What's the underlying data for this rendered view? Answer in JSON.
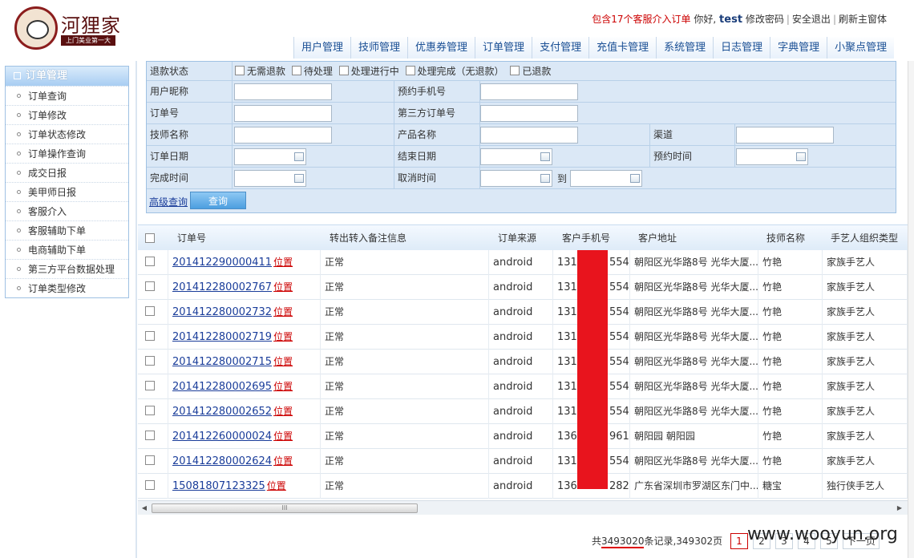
{
  "header": {
    "logo_title": "河狸家",
    "logo_subtitle": "上门美业第一大",
    "alert_text": "包含17个客服介入订单",
    "greeting": "你好,",
    "username": "test",
    "links": [
      "修改密码",
      "安全退出",
      "刷新主窗体"
    ],
    "nav": [
      "用户管理",
      "技师管理",
      "优惠券管理",
      "订单管理",
      "支付管理",
      "充值卡管理",
      "系统管理",
      "日志管理",
      "字典管理",
      "小聚点管理"
    ]
  },
  "sidebar": {
    "title": "订单管理",
    "items": [
      "订单查询",
      "订单修改",
      "订单状态修改",
      "订单操作查询",
      "成交日报",
      "美甲师日报",
      "客服介入",
      "客服辅助下单",
      "电商辅助下单",
      "第三方平台数据处理",
      "订单类型修改"
    ]
  },
  "form": {
    "refund_label": "退款状态",
    "refund_options": [
      "无需退款",
      "待处理",
      "处理进行中",
      "处理完成（无退款）",
      "已退款"
    ],
    "user_nick_label": "用户昵称",
    "phone_label": "预约手机号",
    "order_no_label": "订单号",
    "third_order_label": "第三方订单号",
    "tech_label": "技师名称",
    "product_label": "产品名称",
    "channel_label": "渠道",
    "order_date_label": "订单日期",
    "end_date_label": "结束日期",
    "appoint_time_label": "预约时间",
    "finish_time_label": "完成时间",
    "cancel_time_label": "取消时间",
    "to_label": "到",
    "advanced_link": "高级查询",
    "query_button": "查询"
  },
  "table": {
    "headers": [
      "订单号",
      "转出转入备注信息",
      "订单来源",
      "客户手机号",
      "客户地址",
      "技师名称",
      "手艺人组织类型"
    ],
    "rows": [
      {
        "order": "201412290000411",
        "loc": "位置",
        "remark": "正常",
        "source": "android",
        "phone_pre": "131",
        "phone_suf": "554",
        "addr": "朝阳区光华路8号 光华大厦...",
        "tech": "竹艳",
        "type": "家族手艺人"
      },
      {
        "order": "201412280002767",
        "loc": "位置",
        "remark": "正常",
        "source": "android",
        "phone_pre": "131",
        "phone_suf": "554",
        "addr": "朝阳区光华路8号 光华大厦...",
        "tech": "竹艳",
        "type": "家族手艺人"
      },
      {
        "order": "201412280002732",
        "loc": "位置",
        "remark": "正常",
        "source": "android",
        "phone_pre": "131",
        "phone_suf": "554",
        "addr": "朝阳区光华路8号 光华大厦...",
        "tech": "竹艳",
        "type": "家族手艺人"
      },
      {
        "order": "201412280002719",
        "loc": "位置",
        "remark": "正常",
        "source": "android",
        "phone_pre": "131",
        "phone_suf": "554",
        "addr": "朝阳区光华路8号 光华大厦...",
        "tech": "竹艳",
        "type": "家族手艺人"
      },
      {
        "order": "201412280002715",
        "loc": "位置",
        "remark": "正常",
        "source": "android",
        "phone_pre": "131",
        "phone_suf": "554",
        "addr": "朝阳区光华路8号 光华大厦...",
        "tech": "竹艳",
        "type": "家族手艺人"
      },
      {
        "order": "201412280002695",
        "loc": "位置",
        "remark": "正常",
        "source": "android",
        "phone_pre": "131",
        "phone_suf": "554",
        "addr": "朝阳区光华路8号 光华大厦...",
        "tech": "竹艳",
        "type": "家族手艺人"
      },
      {
        "order": "201412280002652",
        "loc": "位置",
        "remark": "正常",
        "source": "android",
        "phone_pre": "131",
        "phone_suf": "554",
        "addr": "朝阳区光华路8号 光华大厦...",
        "tech": "竹艳",
        "type": "家族手艺人"
      },
      {
        "order": "201412260000024",
        "loc": "位置",
        "remark": "正常",
        "source": "android",
        "phone_pre": "136",
        "phone_suf": "961",
        "addr": "朝阳园 朝阳园",
        "tech": "竹艳",
        "type": "家族手艺人"
      },
      {
        "order": "201412280002624",
        "loc": "位置",
        "remark": "正常",
        "source": "android",
        "phone_pre": "131",
        "phone_suf": "554",
        "addr": "朝阳区光华路8号 光华大厦...",
        "tech": "竹艳",
        "type": "家族手艺人"
      },
      {
        "order": "15081807123325",
        "loc": "位置",
        "remark": "正常",
        "source": "android",
        "phone_pre": "136",
        "phone_suf": "282",
        "addr": "广东省深圳市罗湖区东门中...",
        "tech": "糖宝",
        "type": "独行侠手艺人"
      }
    ]
  },
  "scrollbar": {
    "grip": "III"
  },
  "pager": {
    "prefix": "共",
    "total": "3493020",
    "middle": "条记录,349302页",
    "pages": [
      "1",
      "2",
      "3",
      "4",
      "5"
    ],
    "current": "1",
    "next": "下一页"
  },
  "watermark": "www.wooyun.org",
  "colors": {
    "redaction": "#e8141d",
    "link": "#1a3d9a",
    "alert": "#cc0000",
    "nav_text": "#1a4f94"
  }
}
